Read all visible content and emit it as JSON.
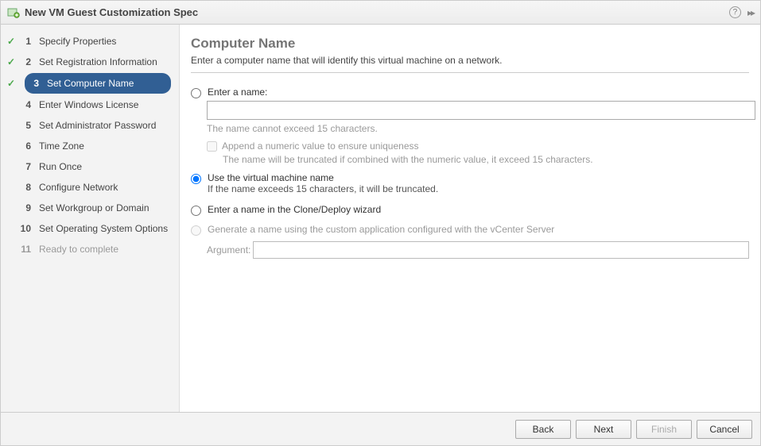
{
  "titlebar": {
    "title": "New VM Guest Customization Spec"
  },
  "sidebar": {
    "steps": [
      {
        "num": "1",
        "label": "Specify Properties"
      },
      {
        "num": "2",
        "label": "Set Registration Information"
      },
      {
        "num": "3",
        "label": "Set Computer Name"
      },
      {
        "num": "4",
        "label": "Enter Windows License"
      },
      {
        "num": "5",
        "label": "Set Administrator Password"
      },
      {
        "num": "6",
        "label": "Time Zone"
      },
      {
        "num": "7",
        "label": "Run Once"
      },
      {
        "num": "8",
        "label": "Configure Network"
      },
      {
        "num": "9",
        "label": "Set Workgroup or Domain"
      },
      {
        "num": "10",
        "label": "Set Operating System Options"
      },
      {
        "num": "11",
        "label": "Ready to complete"
      }
    ]
  },
  "main": {
    "heading": "Computer Name",
    "description": "Enter a computer name that will identify this virtual machine on a network.",
    "opt_enter_name": "Enter a name:",
    "name_hint": "The name cannot exceed 15 characters.",
    "append_label": "Append a numeric value to ensure uniqueness",
    "append_hint": "The name will be truncated if combined with the numeric value, it exceed 15 characters.",
    "opt_use_vm_name": "Use the virtual machine name",
    "use_vm_hint": "If the name exceeds 15 characters, it will be truncated.",
    "opt_clone_wizard": "Enter a name in the Clone/Deploy wizard",
    "opt_generate": "Generate a name using the custom application configured with the vCenter Server",
    "argument_label": "Argument:"
  },
  "footer": {
    "back": "Back",
    "next": "Next",
    "finish": "Finish",
    "cancel": "Cancel"
  }
}
